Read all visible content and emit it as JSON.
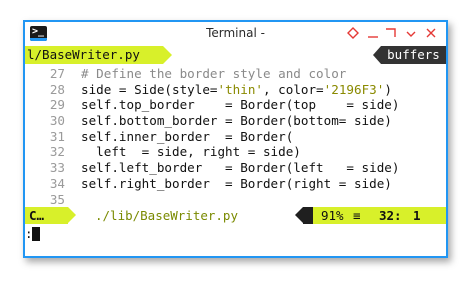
{
  "window": {
    "title": "Terminal -",
    "accent_color": "#2196F3",
    "controls": [
      "diamond-icon",
      "minimize-icon",
      "maximize-icon",
      "restore-icon",
      "close-icon"
    ]
  },
  "editor": {
    "active_tab": "l/BaseWriter.py",
    "buffers_label": "buffers",
    "lines": [
      {
        "num": "27",
        "text": "# Define the border style and color"
      },
      {
        "num": "28",
        "text": "side = Side(style='thin', color='2196F3')"
      },
      {
        "num": "29",
        "text": "self.top_border    = Border(top    = side)"
      },
      {
        "num": "30",
        "text": "self.bottom_border = Border(bottom= side)"
      },
      {
        "num": "31",
        "text": "self.inner_border  = Border("
      },
      {
        "num": "32",
        "text": "  left  = side, right = side)"
      },
      {
        "num": "33",
        "text": "self.left_border   = Border(left   = side)"
      },
      {
        "num": "34",
        "text": "self.right_border  = Border(right = side)"
      },
      {
        "num": "35",
        "text": ""
      }
    ]
  },
  "statusline": {
    "mode": "C…",
    "filepath": "./lib/BaseWriter.py",
    "percent": "91%",
    "menu_glyph": "≡",
    "line": "32:",
    "column": "1"
  },
  "cmdline": {
    "text": ":"
  }
}
